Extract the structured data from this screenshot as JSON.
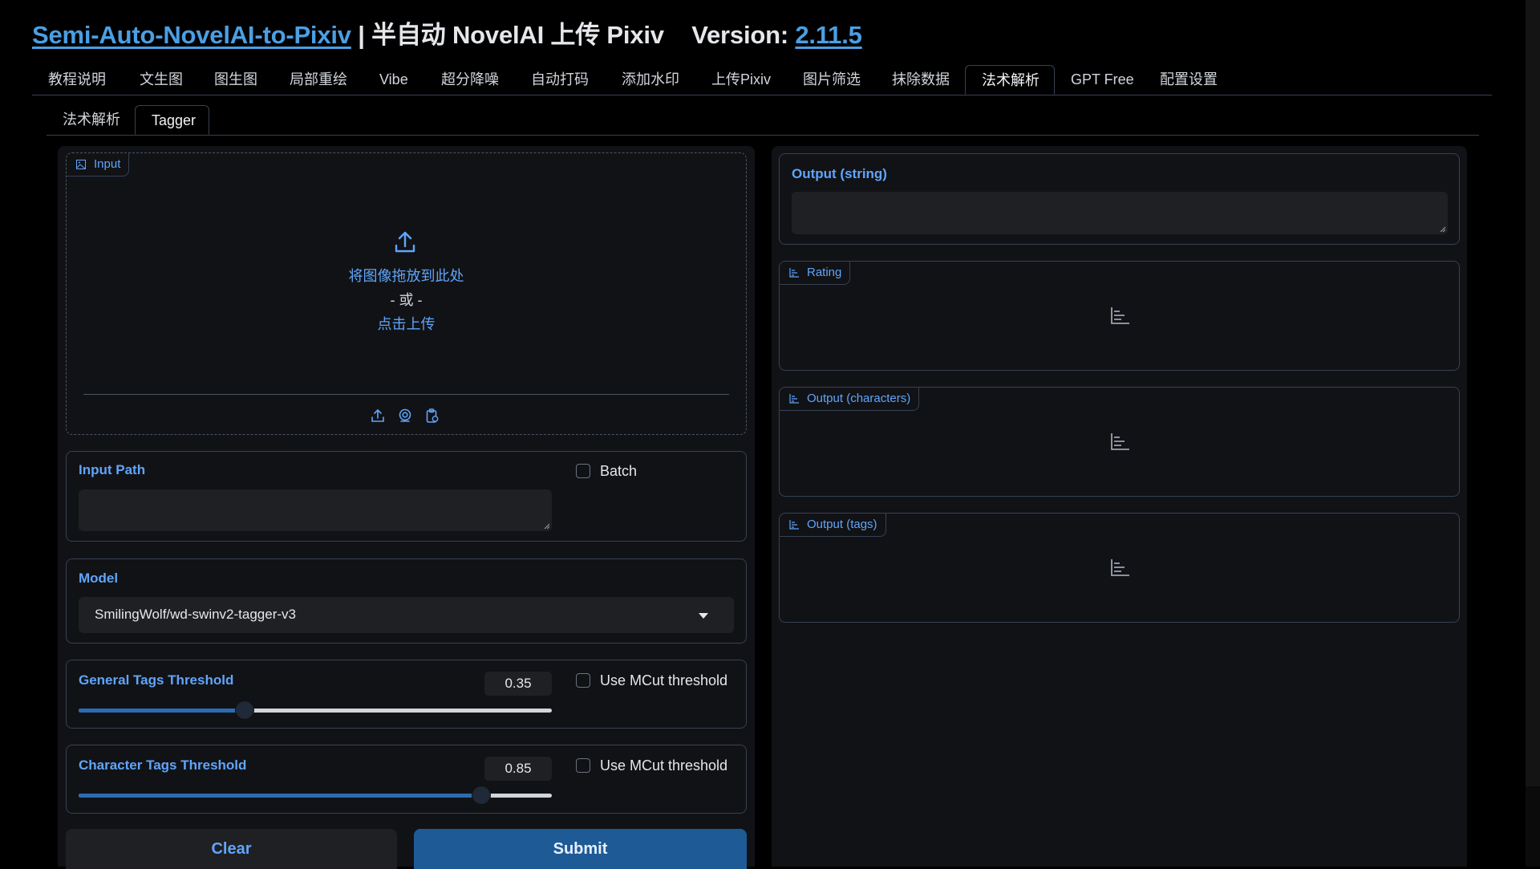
{
  "header": {
    "app_link": "Semi-Auto-NovelAI-to-Pixiv",
    "separator": "|",
    "subtitle": "半自动 NovelAI 上传 Pixiv",
    "version_label": "Version:",
    "version": "2.11.5"
  },
  "main_tabs": [
    {
      "label": "教程说明"
    },
    {
      "label": "文生图"
    },
    {
      "label": "图生图"
    },
    {
      "label": "局部重绘"
    },
    {
      "label": "Vibe"
    },
    {
      "label": "超分降噪"
    },
    {
      "label": "自动打码"
    },
    {
      "label": "添加水印"
    },
    {
      "label": "上传Pixiv"
    },
    {
      "label": "图片筛选"
    },
    {
      "label": "抹除数据"
    },
    {
      "label": "法术解析"
    },
    {
      "label": "GPT Free"
    },
    {
      "label": "配置设置"
    }
  ],
  "active_main_tab": "法术解析",
  "sub_tabs": [
    {
      "label": "法术解析"
    },
    {
      "label": "Tagger"
    }
  ],
  "active_sub_tab": "Tagger",
  "input_image": {
    "label": "Input",
    "drop_text": "将图像拖放到此处",
    "or_text": "- 或 -",
    "click_text": "点击上传"
  },
  "input_path": {
    "label": "Input Path",
    "value": "",
    "batch_label": "Batch",
    "batch_checked": false
  },
  "model": {
    "label": "Model",
    "selected": "SmilingWolf/wd-swinv2-tagger-v3"
  },
  "general_threshold": {
    "label": "General Tags Threshold",
    "value": "0.35",
    "fraction": 0.35,
    "mcut_label": "Use MCut threshold",
    "mcut_checked": false
  },
  "character_threshold": {
    "label": "Character Tags Threshold",
    "value": "0.85",
    "fraction": 0.85,
    "mcut_label": "Use MCut threshold",
    "mcut_checked": false
  },
  "buttons": {
    "clear": "Clear",
    "submit": "Submit"
  },
  "outputs": {
    "string_label": "Output (string)",
    "rating_label": "Rating",
    "characters_label": "Output (characters)",
    "tags_label": "Output (tags)"
  },
  "colors": {
    "accent": "#60a5fa",
    "primary_button": "#1e5a96",
    "panel": "#111216",
    "border": "#374151"
  }
}
